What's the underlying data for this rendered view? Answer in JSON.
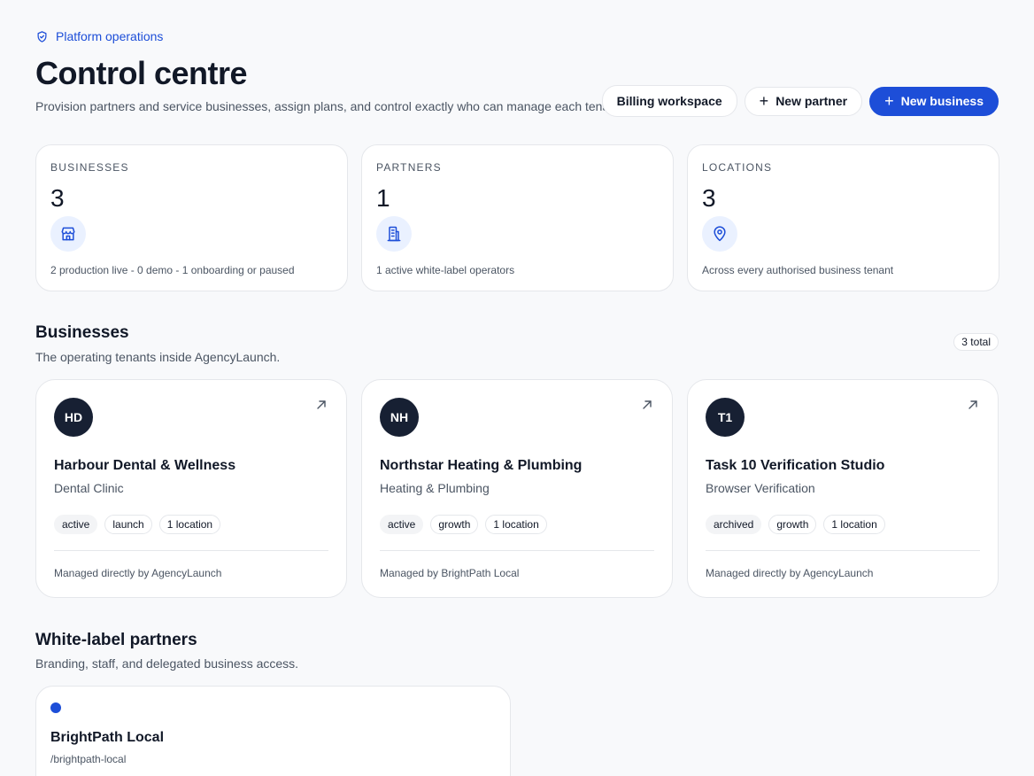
{
  "header": {
    "eyebrow": "Platform operations",
    "title": "Control centre",
    "subtitle": "Provision partners and service businesses, assign plans, and control exactly who can manage each tenant.",
    "actions": {
      "billing": "Billing workspace",
      "new_partner": "New partner",
      "new_business": "New business"
    }
  },
  "stats": [
    {
      "label": "BUSINESSES",
      "value": "3",
      "icon": "store-icon",
      "note": "2 production live - 0 demo - 1 onboarding or paused"
    },
    {
      "label": "PARTNERS",
      "value": "1",
      "icon": "building-icon",
      "note": "1 active white-label operators"
    },
    {
      "label": "LOCATIONS",
      "value": "3",
      "icon": "map-pin-icon",
      "note": "Across every authorised business tenant"
    }
  ],
  "businesses_section": {
    "title": "Businesses",
    "subtitle": "The operating tenants inside AgencyLaunch.",
    "count": "3 total",
    "items": [
      {
        "initials": "HD",
        "name": "Harbour Dental & Wellness",
        "category": "Dental Clinic",
        "status": "active",
        "plan": "launch",
        "locations": "1 location",
        "manager": "Managed directly by AgencyLaunch"
      },
      {
        "initials": "NH",
        "name": "Northstar Heating & Plumbing",
        "category": "Heating & Plumbing",
        "status": "active",
        "plan": "growth",
        "locations": "1 location",
        "manager": "Managed by BrightPath Local"
      },
      {
        "initials": "T1",
        "name": "Task 10 Verification Studio",
        "category": "Browser Verification",
        "status": "archived",
        "plan": "growth",
        "locations": "1 location",
        "manager": "Managed directly by AgencyLaunch"
      }
    ]
  },
  "partners_section": {
    "title": "White-label partners",
    "subtitle": "Branding, staff, and delegated business access.",
    "items": [
      {
        "name": "BrightPath Local",
        "slug": "/brightpath-local",
        "accent": "#1d4ed8"
      }
    ]
  },
  "colors": {
    "accent": "#1d4ed8",
    "avatar_bg": "#172033",
    "icon_bg": "#eaf1ff"
  }
}
